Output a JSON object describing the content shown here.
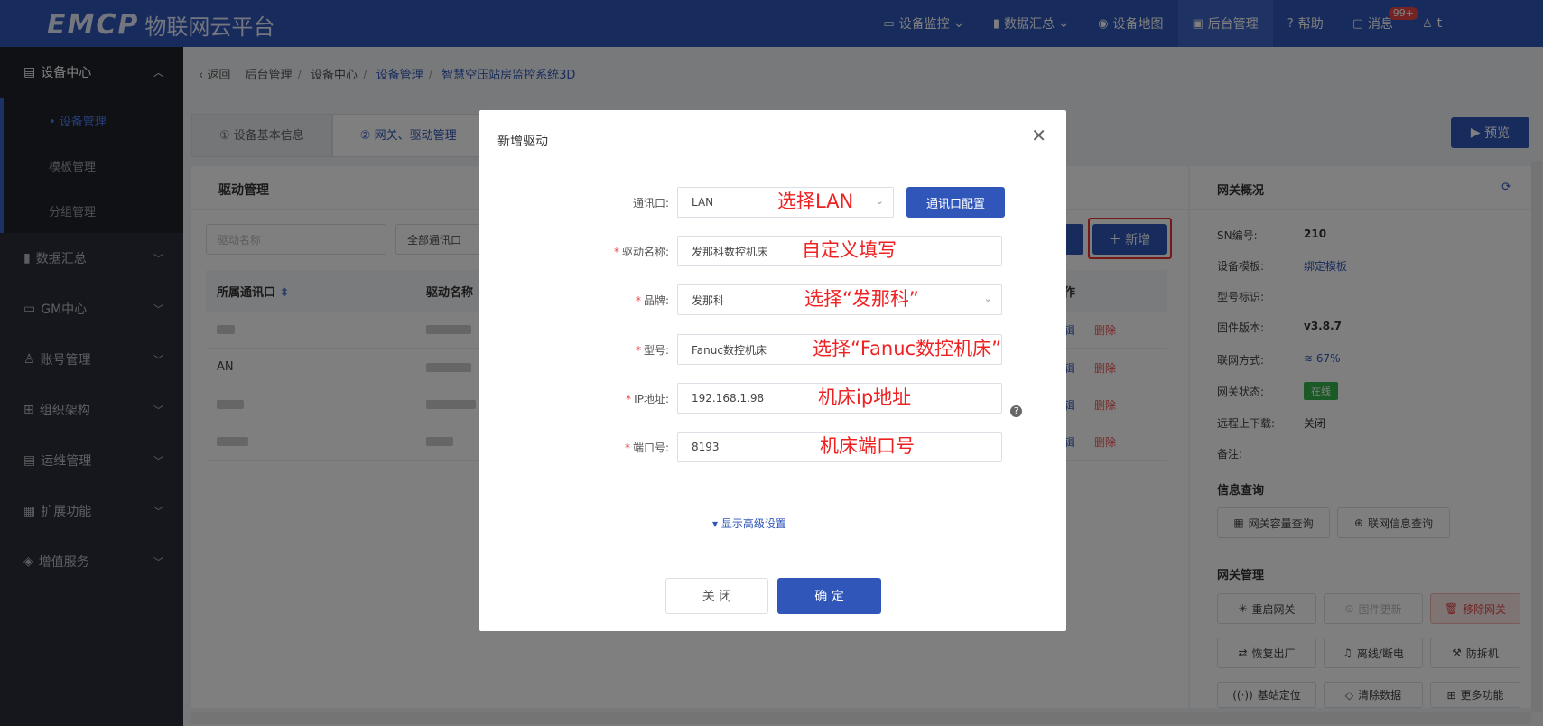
{
  "topbar": {
    "brand": "EMCP",
    "subtitle": "物联网云平台",
    "nav": [
      {
        "label": "设备监控",
        "icon": "monitor-icon",
        "chevron": true
      },
      {
        "label": "数据汇总",
        "icon": "chart-icon",
        "chevron": true
      },
      {
        "label": "设备地图",
        "icon": "map-pin-icon",
        "chevron": false
      },
      {
        "label": "后台管理",
        "icon": "admin-icon",
        "chevron": false,
        "active": true
      },
      {
        "label": "帮助",
        "icon": "help-icon",
        "chevron": false
      },
      {
        "label": "消息",
        "icon": "message-icon",
        "chevron": false,
        "badge": "99+"
      },
      {
        "label": "t",
        "icon": "user-icon",
        "chevron": false
      }
    ]
  },
  "sidebar": {
    "groups": [
      {
        "label": "设备中心",
        "icon": "device-icon",
        "open": true,
        "items": [
          {
            "label": "• 设备管理",
            "active": true
          },
          {
            "label": "模板管理",
            "active": false
          },
          {
            "label": "分组管理",
            "active": false
          }
        ]
      },
      {
        "label": "数据汇总",
        "icon": "chart-icon"
      },
      {
        "label": "GM中心",
        "icon": "gm-icon"
      },
      {
        "label": "账号管理",
        "icon": "account-icon"
      },
      {
        "label": "组织架构",
        "icon": "org-icon"
      },
      {
        "label": "运维管理",
        "icon": "ops-icon"
      },
      {
        "label": "扩展功能",
        "icon": "extend-icon"
      },
      {
        "label": "增值服务",
        "icon": "value-icon"
      }
    ]
  },
  "breadcrumb": {
    "back": "返回",
    "items": [
      "后台管理",
      "设备中心",
      "设备管理",
      "智慧空压站房监控系统3D"
    ]
  },
  "tabs": [
    {
      "label": "① 设备基本信息",
      "active": false
    },
    {
      "label": "② 网关、驱动管理",
      "active": true
    }
  ],
  "preview_label": "预览",
  "drivers": {
    "title": "驱动管理",
    "search_placeholder": "驱动名称",
    "port_filter": "全部通讯口",
    "add_label": "新增",
    "columns": [
      "所属通讯口",
      "驱动名称"
    ],
    "action_header": "作",
    "rows": [
      {
        "port": "",
        "edit": "辑",
        "delete": "删除"
      },
      {
        "port": "AN",
        "edit": "辑",
        "delete": "删除"
      },
      {
        "port": "",
        "edit": "辑",
        "delete": "删除"
      },
      {
        "port": "",
        "edit": "辑",
        "delete": "删除"
      }
    ]
  },
  "gateway": {
    "title": "网关概况",
    "fields": [
      {
        "label": "SN编号:",
        "value": "210"
      },
      {
        "label": "设备模板:",
        "value": "绑定模板"
      },
      {
        "label": "型号标识:",
        "value": ""
      },
      {
        "label": "固件版本:",
        "value": "v3.8.7"
      },
      {
        "label": "联网方式:",
        "value": "67%"
      },
      {
        "label": "网关状态:",
        "value": "在线"
      },
      {
        "label": "远程上下载:",
        "value": "关闭"
      },
      {
        "label": "备注:",
        "value": ""
      }
    ],
    "info_title": "信息查询",
    "info_buttons": [
      "网关容量查询",
      "联网信息查询"
    ],
    "manage_title": "网关管理",
    "manage_buttons": [
      "重启网关",
      "固件更新",
      "移除网关",
      "恢复出厂",
      "离线/断电",
      "防拆机",
      "基站定位",
      "清除数据",
      "更多功能"
    ]
  },
  "modal": {
    "title": "新增驱动",
    "fields": [
      {
        "label": "通讯口:",
        "required": false,
        "value": "LAN",
        "annotation": "选择LAN"
      },
      {
        "label": "驱动名称:",
        "required": true,
        "value": "发那科数控机床",
        "annotation": "自定义填写"
      },
      {
        "label": "品牌:",
        "required": true,
        "value": "发那科",
        "annotation": "选择“发那科”"
      },
      {
        "label": "型号:",
        "required": true,
        "value": "Fanuc数控机床",
        "annotation": "选择“Fanuc数控机床”"
      },
      {
        "label": "IP地址:",
        "required": true,
        "value": "192.168.1.98",
        "annotation": "机床ip地址"
      },
      {
        "label": "端口号:",
        "required": true,
        "value": "8193",
        "annotation": "机床端口号"
      }
    ],
    "config_button": "通讯口配置",
    "advanced": "显示高级设置",
    "close_button": "关 闭",
    "ok_button": "确 定"
  }
}
